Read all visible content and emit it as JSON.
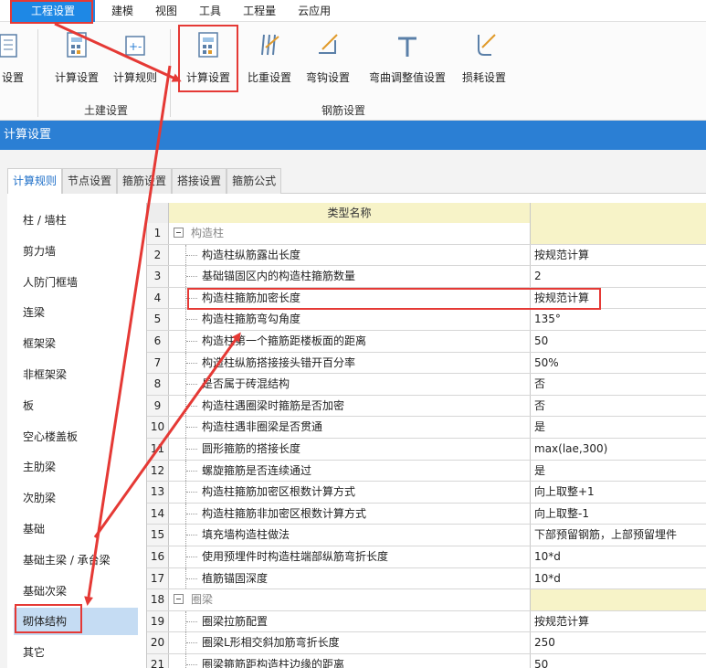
{
  "menu": {
    "items": [
      "工程设置",
      "建模",
      "视图",
      "工具",
      "工程量",
      "云应用"
    ],
    "active_index": 0
  },
  "ribbon": {
    "partial_button_label": "设置",
    "buttons": [
      {
        "label": "计算设置",
        "icon": "calc-settings-icon"
      },
      {
        "label": "计算规则",
        "icon": "calc-rules-icon"
      },
      {
        "label": "计算设置",
        "icon": "rebar-calc-settings-icon"
      },
      {
        "label": "比重设置",
        "icon": "weight-settings-icon"
      },
      {
        "label": "弯钩设置",
        "icon": "hook-settings-icon"
      },
      {
        "label": "弯曲调整值设置",
        "icon": "bend-adjust-icon"
      },
      {
        "label": "损耗设置",
        "icon": "loss-settings-icon"
      }
    ],
    "groups": [
      "土建设置",
      "钢筋设置"
    ]
  },
  "window_title": "计算设置",
  "tabs": [
    "计算规则",
    "节点设置",
    "箍筋设置",
    "搭接设置",
    "箍筋公式"
  ],
  "left_list": [
    "柱 / 墙柱",
    "剪力墙",
    "人防门框墙",
    "连梁",
    "框架梁",
    "非框架梁",
    "板",
    "空心楼盖板",
    "主肋梁",
    "次肋梁",
    "基础",
    "基础主梁 / 承台梁",
    "基础次梁",
    "砌体结构",
    "其它"
  ],
  "selected_left_index": 13,
  "grid": {
    "header": "类型名称",
    "rows": [
      {
        "num": "1",
        "name": "构造柱",
        "value": "",
        "group": true
      },
      {
        "num": "2",
        "name": "构造柱纵筋露出长度",
        "value": "按规范计算"
      },
      {
        "num": "3",
        "name": "基础锚固区内的构造柱箍筋数量",
        "value": "2"
      },
      {
        "num": "4",
        "name": "构造柱箍筋加密长度",
        "value": "按规范计算"
      },
      {
        "num": "5",
        "name": "构造柱箍筋弯勾角度",
        "value": "135°"
      },
      {
        "num": "6",
        "name": "构造柱第一个箍筋距楼板面的距离",
        "value": "50"
      },
      {
        "num": "7",
        "name": "构造柱纵筋搭接接头错开百分率",
        "value": "50%"
      },
      {
        "num": "8",
        "name": "是否属于砖混结构",
        "value": "否"
      },
      {
        "num": "9",
        "name": "构造柱遇圈梁时箍筋是否加密",
        "value": "否"
      },
      {
        "num": "10",
        "name": "构造柱遇非圈梁是否贯通",
        "value": "是"
      },
      {
        "num": "11",
        "name": "圆形箍筋的搭接长度",
        "value": "max(lae,300)"
      },
      {
        "num": "12",
        "name": "螺旋箍筋是否连续通过",
        "value": "是"
      },
      {
        "num": "13",
        "name": "构造柱箍筋加密区根数计算方式",
        "value": "向上取整+1"
      },
      {
        "num": "14",
        "name": "构造柱箍筋非加密区根数计算方式",
        "value": "向上取整-1"
      },
      {
        "num": "15",
        "name": "填充墙构造柱做法",
        "value": "下部预留钢筋，上部预留埋件"
      },
      {
        "num": "16",
        "name": "使用预埋件时构造柱端部纵筋弯折长度",
        "value": "10*d"
      },
      {
        "num": "17",
        "name": "植筋锚固深度",
        "value": "10*d"
      },
      {
        "num": "18",
        "name": "圈梁",
        "value": "",
        "group": true
      },
      {
        "num": "19",
        "name": "圈梁拉筋配置",
        "value": "按规范计算"
      },
      {
        "num": "20",
        "name": "圈梁L形相交斜加筋弯折长度",
        "value": "250"
      },
      {
        "num": "21",
        "name": "圈梁箍筋距构造柱边缘的距离",
        "value": "50"
      }
    ]
  },
  "colors": {
    "accent": "#2b7fd4",
    "menu_active": "#1e88e5",
    "highlight": "#e53935",
    "selected_row": "#c5dcf3",
    "grid_header": "#f7f3c8"
  }
}
